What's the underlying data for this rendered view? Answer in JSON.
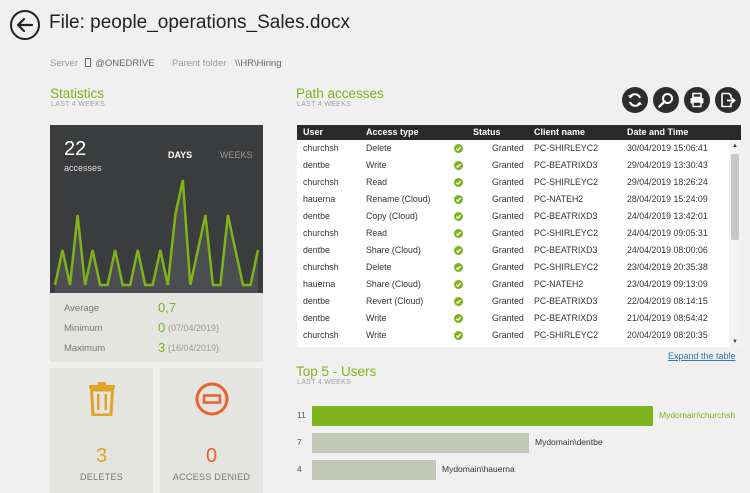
{
  "header": {
    "title": "File: people_operations_Sales.docx",
    "server_label": "Server",
    "server_value": "@ONEDRIVE",
    "parent_label": "Parent folder",
    "parent_value": "\\\\HR\\Hiring"
  },
  "statistics": {
    "title": "Statistics",
    "subtitle": "LAST 4 WEEKS",
    "count": "22",
    "count_label": "accesses",
    "tab_days": "DAYS",
    "tab_weeks": "WEEKS",
    "average_label": "Average",
    "average_value": "0,7",
    "minimum_label": "Minimum",
    "minimum_value": "0",
    "minimum_date": "(07/04/2019)",
    "maximum_label": "Maximum",
    "maximum_value": "3",
    "maximum_date": "(16/04/2019)",
    "chart_data": {
      "type": "area",
      "x": [
        1,
        2,
        3,
        4,
        5,
        6,
        7,
        8,
        9,
        10,
        11,
        12,
        13,
        14,
        15,
        16,
        17,
        18,
        19,
        20,
        21,
        22,
        23,
        24,
        25,
        26,
        27,
        28
      ],
      "values": [
        0,
        1,
        0,
        2,
        0,
        1,
        0,
        0,
        1,
        0,
        0,
        1,
        0,
        0,
        1,
        0,
        2,
        3,
        0,
        1,
        2,
        0,
        0,
        2,
        1,
        0,
        0,
        1
      ],
      "ylim": [
        0,
        3
      ],
      "accent": "#7fb31b"
    },
    "deletes_value": "3",
    "deletes_label": "DELETES",
    "denied_value": "0",
    "denied_label": "ACCESS DENIED"
  },
  "path_accesses": {
    "title": "Path accesses",
    "subtitle": "LAST 4 WEEKS",
    "tools": [
      "refresh-icon",
      "search-icon",
      "print-icon",
      "export-icon"
    ],
    "columns": [
      "User",
      "Access type",
      "Status",
      "Client name",
      "Date and Time"
    ],
    "rows": [
      {
        "user": "churchsh",
        "type": "Delete",
        "status": "Granted",
        "client": "PC-SHIRLEYC2",
        "date": "30/04/2019 15:06:41"
      },
      {
        "user": "dentbe",
        "type": "Write",
        "status": "Granted",
        "client": "PC-BEATRIXD3",
        "date": "29/04/2019 13:30:43"
      },
      {
        "user": "churchsh",
        "type": "Read",
        "status": "Granted",
        "client": "PC-SHIRLEYC2",
        "date": "29/04/2019 18:26:24"
      },
      {
        "user": "hauerna",
        "type": "Rename (Cloud)",
        "status": "Granted",
        "client": "PC-NATEH2",
        "date": "28/04/2019 15:24:09"
      },
      {
        "user": "dentbe",
        "type": "Copy (Cloud)",
        "status": "Granted",
        "client": "PC-BEATRIXD3",
        "date": "24/04/2019 13:42:01"
      },
      {
        "user": "churchsh",
        "type": "Read",
        "status": "Granted",
        "client": "PC-SHIRLEYC2",
        "date": "24/04/2019 09:05:31"
      },
      {
        "user": "dentbe",
        "type": "Share (Cloud)",
        "status": "Granted",
        "client": "PC-BEATRIXD3",
        "date": "24/04/2019 08:00:06"
      },
      {
        "user": "churchsh",
        "type": "Delete",
        "status": "Granted",
        "client": "PC-SHIRLEYC2",
        "date": "23/04/2019 20:35:38"
      },
      {
        "user": "hauerna",
        "type": "Share (Cloud)",
        "status": "Granted",
        "client": "PC-NATEH2",
        "date": "23/04/2019 09:13:09"
      },
      {
        "user": "dentbe",
        "type": "Revert  (Cloud)",
        "status": "Granted",
        "client": "PC-BEATRIXD3",
        "date": "22/04/2019 08:14:15"
      },
      {
        "user": "dentbe",
        "type": "Write",
        "status": "Granted",
        "client": "PC-BEATRIXD3",
        "date": "21/04/2019 08:54:42"
      },
      {
        "user": "churchsh",
        "type": "Write",
        "status": "Granted",
        "client": "PC-SHIRLEYC2",
        "date": "20/04/2019 08:20:35"
      }
    ],
    "expand_label": "Expand the table"
  },
  "top_users": {
    "title": "Top 5 - Users",
    "subtitle": "LAST 4 WEEKS",
    "chart_data": {
      "type": "bar",
      "categories": [
        "Mydomain\\churchsh",
        "Mydomain\\dentbe",
        "Mydomain\\hauerna"
      ],
      "values": [
        11,
        7,
        4
      ],
      "colors": [
        "#7fb31b",
        "#c4c8b8",
        "#c4c8b8"
      ]
    }
  }
}
